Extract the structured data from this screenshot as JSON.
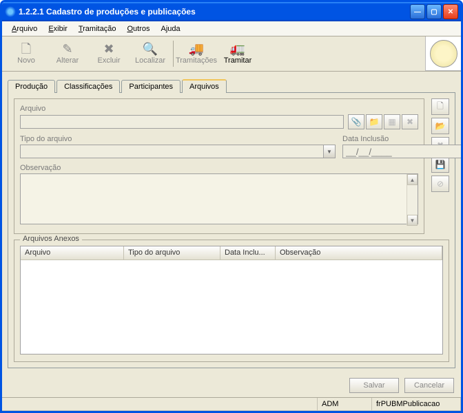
{
  "window": {
    "title": "1.2.2.1 Cadastro de produções e publicações"
  },
  "menus": {
    "items": [
      "Arquivo",
      "Exibir",
      "Tramitação",
      "Outros",
      "Ajuda"
    ]
  },
  "toolbar": {
    "novo": "Novo",
    "alterar": "Alterar",
    "excluir": "Excluir",
    "localizar": "Localizar",
    "tramitacoes": "Tramitações",
    "tramitar": "Tramitar"
  },
  "tabs": {
    "items": [
      "Produção",
      "Classificações",
      "Participantes",
      "Arquivos"
    ],
    "active": 3
  },
  "form": {
    "arquivo_label": "Arquivo",
    "arquivo_value": "",
    "tipo_label": "Tipo do arquivo",
    "tipo_value": "",
    "data_label": "Data Inclusão",
    "data_placeholder": "__/__/____",
    "obs_label": "Observação",
    "obs_value": ""
  },
  "grid": {
    "legend": "Arquivos Anexos",
    "cols": [
      "Arquivo",
      "Tipo do arquivo",
      "Data Inclu...",
      "Observação"
    ]
  },
  "footer": {
    "salvar": "Salvar",
    "cancelar": "Cancelar"
  },
  "status": {
    "user": "ADM",
    "form": "frPUBMPublicacao"
  }
}
